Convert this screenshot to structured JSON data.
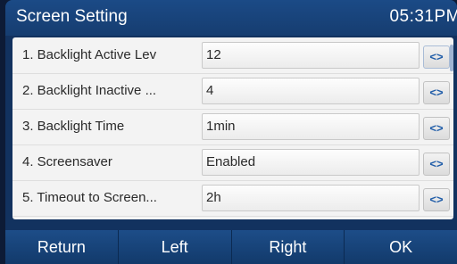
{
  "header": {
    "title": "Screen Setting",
    "time": "05:31PM"
  },
  "settings": [
    {
      "label": "1. Backlight Active Lev",
      "value": "12"
    },
    {
      "label": "2. Backlight Inactive ...",
      "value": "4"
    },
    {
      "label": "3. Backlight Time",
      "value": "1min"
    },
    {
      "label": "4. Screensaver",
      "value": "Enabled"
    },
    {
      "label": "5. Timeout to Screen...",
      "value": "2h"
    }
  ],
  "spinner_glyph": "<>",
  "softkeys": [
    "Return",
    "Left",
    "Right",
    "OK"
  ],
  "colors": {
    "titlebar": "#1b4a86",
    "accent": "#1f5ca8",
    "background": "#12325f"
  }
}
